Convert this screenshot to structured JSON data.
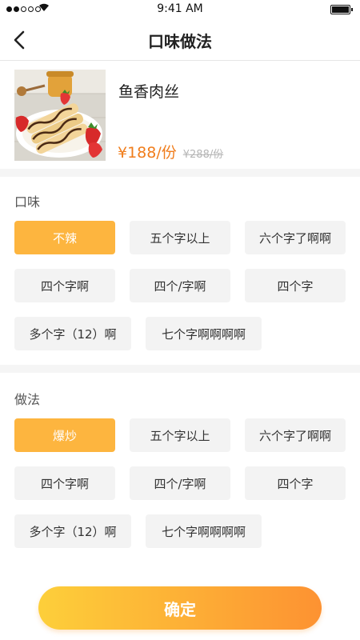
{
  "status_bar": {
    "time": "9:41 AM",
    "carrier_glyph": "☀"
  },
  "header": {
    "title": "口味做法",
    "back_icon": "chevron-left-icon"
  },
  "product": {
    "name": "鱼香肉丝",
    "price": "¥188/份",
    "original_price": "¥288/份",
    "image": "crepes-with-strawberries"
  },
  "taste": {
    "label": "口味",
    "options": [
      "不辣",
      "五个字以上",
      "六个字了啊啊",
      "四个字啊",
      "四个/字啊",
      "四个字",
      "多个字（12）啊",
      "七个字啊啊啊啊"
    ],
    "selected": "不辣"
  },
  "method": {
    "label": "做法",
    "options": [
      "爆炒",
      "五个字以上",
      "六个字了啊啊",
      "四个字啊",
      "四个/字啊",
      "四个字",
      "多个字（12）啊",
      "七个字啊啊啊啊"
    ],
    "selected": "爆炒"
  },
  "confirm": {
    "label": "确定"
  },
  "colors": {
    "accent": "#fdb53f",
    "price": "#f07d1c",
    "button_gradient_start": "#fdcf3a",
    "button_gradient_end": "#fd9232"
  }
}
